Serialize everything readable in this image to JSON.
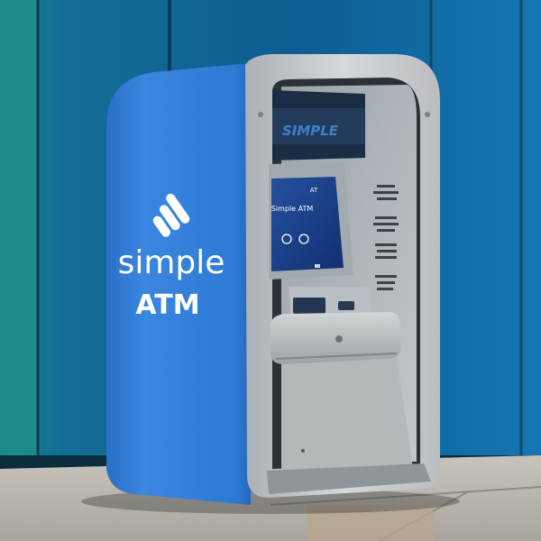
{
  "kiosk": {
    "brand_line1": "simple",
    "brand_line2": "ATM",
    "top_panel_text": "SIMPLE"
  },
  "screen": {
    "corner_text": "AT",
    "title": "Simple ATM"
  },
  "colors": {
    "kiosk_blue": "#2f7fd8",
    "wall_blue": "#0f6fa5",
    "wall_teal": "#1f8f8f",
    "steel": "#c9ccce",
    "screen_blue": "#173f86"
  }
}
